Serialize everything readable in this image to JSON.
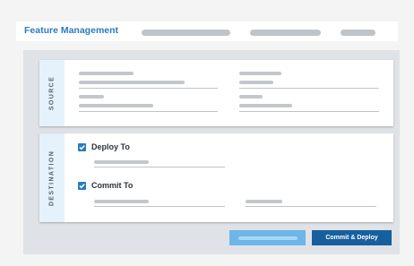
{
  "header": {
    "title": "Feature Management"
  },
  "source_panel": {
    "label": "SOURCE"
  },
  "destination_panel": {
    "label": "DESTINATION",
    "options": [
      {
        "label": "Deploy To",
        "checked": true
      },
      {
        "label": "Commit To",
        "checked": true
      }
    ]
  },
  "footer": {
    "primary_label": "Commit & Deploy"
  },
  "colors": {
    "accent": "#2b7bbf",
    "primary_button": "#16609f",
    "secondary_button": "#6cb6ea",
    "side_tab": "#e6f2fb"
  }
}
